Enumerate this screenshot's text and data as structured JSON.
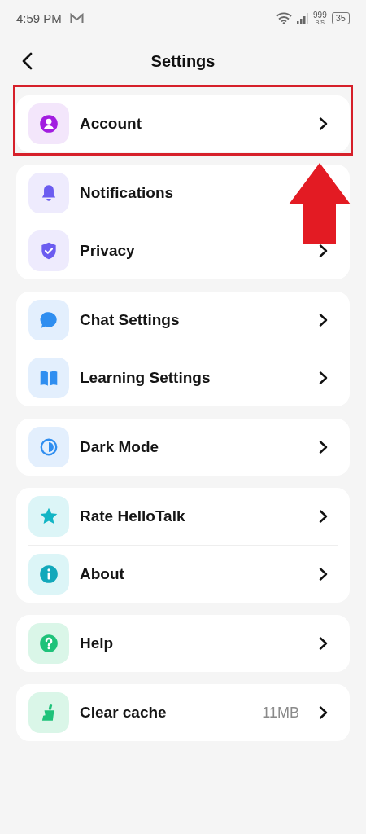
{
  "status_bar": {
    "time": "4:59 PM",
    "net_speed": "999",
    "net_unit": "B/S",
    "battery": "35"
  },
  "header": {
    "title": "Settings"
  },
  "groups": [
    {
      "highlighted": true,
      "items": [
        {
          "label": "Account",
          "kind": "person",
          "chevron": true
        }
      ]
    },
    {
      "highlighted": false,
      "items": [
        {
          "label": "Notifications",
          "kind": "bell",
          "chevron": false
        },
        {
          "label": "Privacy",
          "kind": "shield",
          "chevron": true
        }
      ]
    },
    {
      "highlighted": false,
      "items": [
        {
          "label": "Chat Settings",
          "kind": "chat",
          "chevron": true
        },
        {
          "label": "Learning Settings",
          "kind": "book",
          "chevron": true
        }
      ]
    },
    {
      "highlighted": false,
      "items": [
        {
          "label": "Dark Mode",
          "kind": "contrast",
          "chevron": true
        }
      ]
    },
    {
      "highlighted": false,
      "items": [
        {
          "label": "Rate HelloTalk",
          "kind": "star",
          "chevron": true
        },
        {
          "label": "About",
          "kind": "info",
          "chevron": true
        }
      ]
    },
    {
      "highlighted": false,
      "items": [
        {
          "label": "Help",
          "kind": "help",
          "chevron": true
        }
      ]
    },
    {
      "highlighted": false,
      "items": [
        {
          "label": "Clear cache",
          "kind": "broom",
          "chevron": true,
          "value": "11MB"
        }
      ]
    }
  ]
}
